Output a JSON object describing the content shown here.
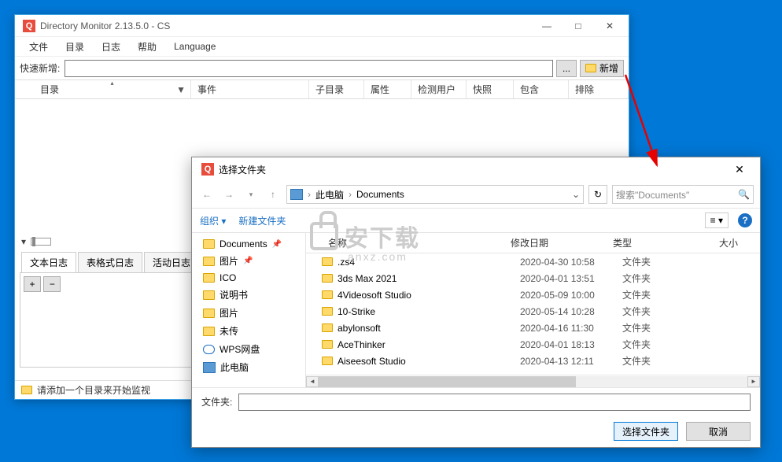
{
  "main": {
    "title": "Directory Monitor 2.13.5.0 - CS",
    "menu": [
      "文件",
      "目录",
      "日志",
      "帮助",
      "Language"
    ],
    "quick_label": "快速新增:",
    "btn_dots": "...",
    "btn_new": "新增",
    "columns": {
      "dir": "目录",
      "event": "事件",
      "subdir": "子目录",
      "attr": "属性",
      "user": "检测用户",
      "snap": "快照",
      "inc": "包含",
      "exc": "排除"
    },
    "tabs": [
      "文本日志",
      "表格式日志",
      "活动日志"
    ],
    "btn_plus": "+",
    "btn_minus": "−",
    "status": "请添加一个目录来开始监视"
  },
  "dialog": {
    "title": "选择文件夹",
    "breadcrumb": {
      "root": "此电脑",
      "loc": "Documents"
    },
    "search_placeholder": "搜索\"Documents\"",
    "toolbar": {
      "org": "组织",
      "newf": "新建文件夹"
    },
    "tree": [
      {
        "name": "Documents",
        "pinned": true
      },
      {
        "name": "图片",
        "pinned": true
      },
      {
        "name": "ICO"
      },
      {
        "name": "说明书"
      },
      {
        "name": "图片"
      },
      {
        "name": "未传"
      },
      {
        "name": "WPS网盘",
        "cloud": true
      },
      {
        "name": "此电脑",
        "pc": true
      }
    ],
    "list_head": {
      "name": "名称",
      "date": "修改日期",
      "type": "类型",
      "size": "大小"
    },
    "files": [
      {
        "name": ".zs4",
        "date": "2020-04-30 10:58",
        "type": "文件夹"
      },
      {
        "name": "3ds Max 2021",
        "date": "2020-04-01 13:51",
        "type": "文件夹"
      },
      {
        "name": "4Videosoft Studio",
        "date": "2020-05-09 10:00",
        "type": "文件夹"
      },
      {
        "name": "10-Strike",
        "date": "2020-05-14 10:28",
        "type": "文件夹"
      },
      {
        "name": "abylonsoft",
        "date": "2020-04-16 11:30",
        "type": "文件夹"
      },
      {
        "name": "AceThinker",
        "date": "2020-04-01 18:13",
        "type": "文件夹"
      },
      {
        "name": "Aiseesoft Studio",
        "date": "2020-04-13 12:11",
        "type": "文件夹"
      }
    ],
    "folder_label": "文件夹:",
    "btn_select": "选择文件夹",
    "btn_cancel": "取消"
  },
  "watermark": {
    "big": "安下载",
    "sub": "anxz.com"
  }
}
